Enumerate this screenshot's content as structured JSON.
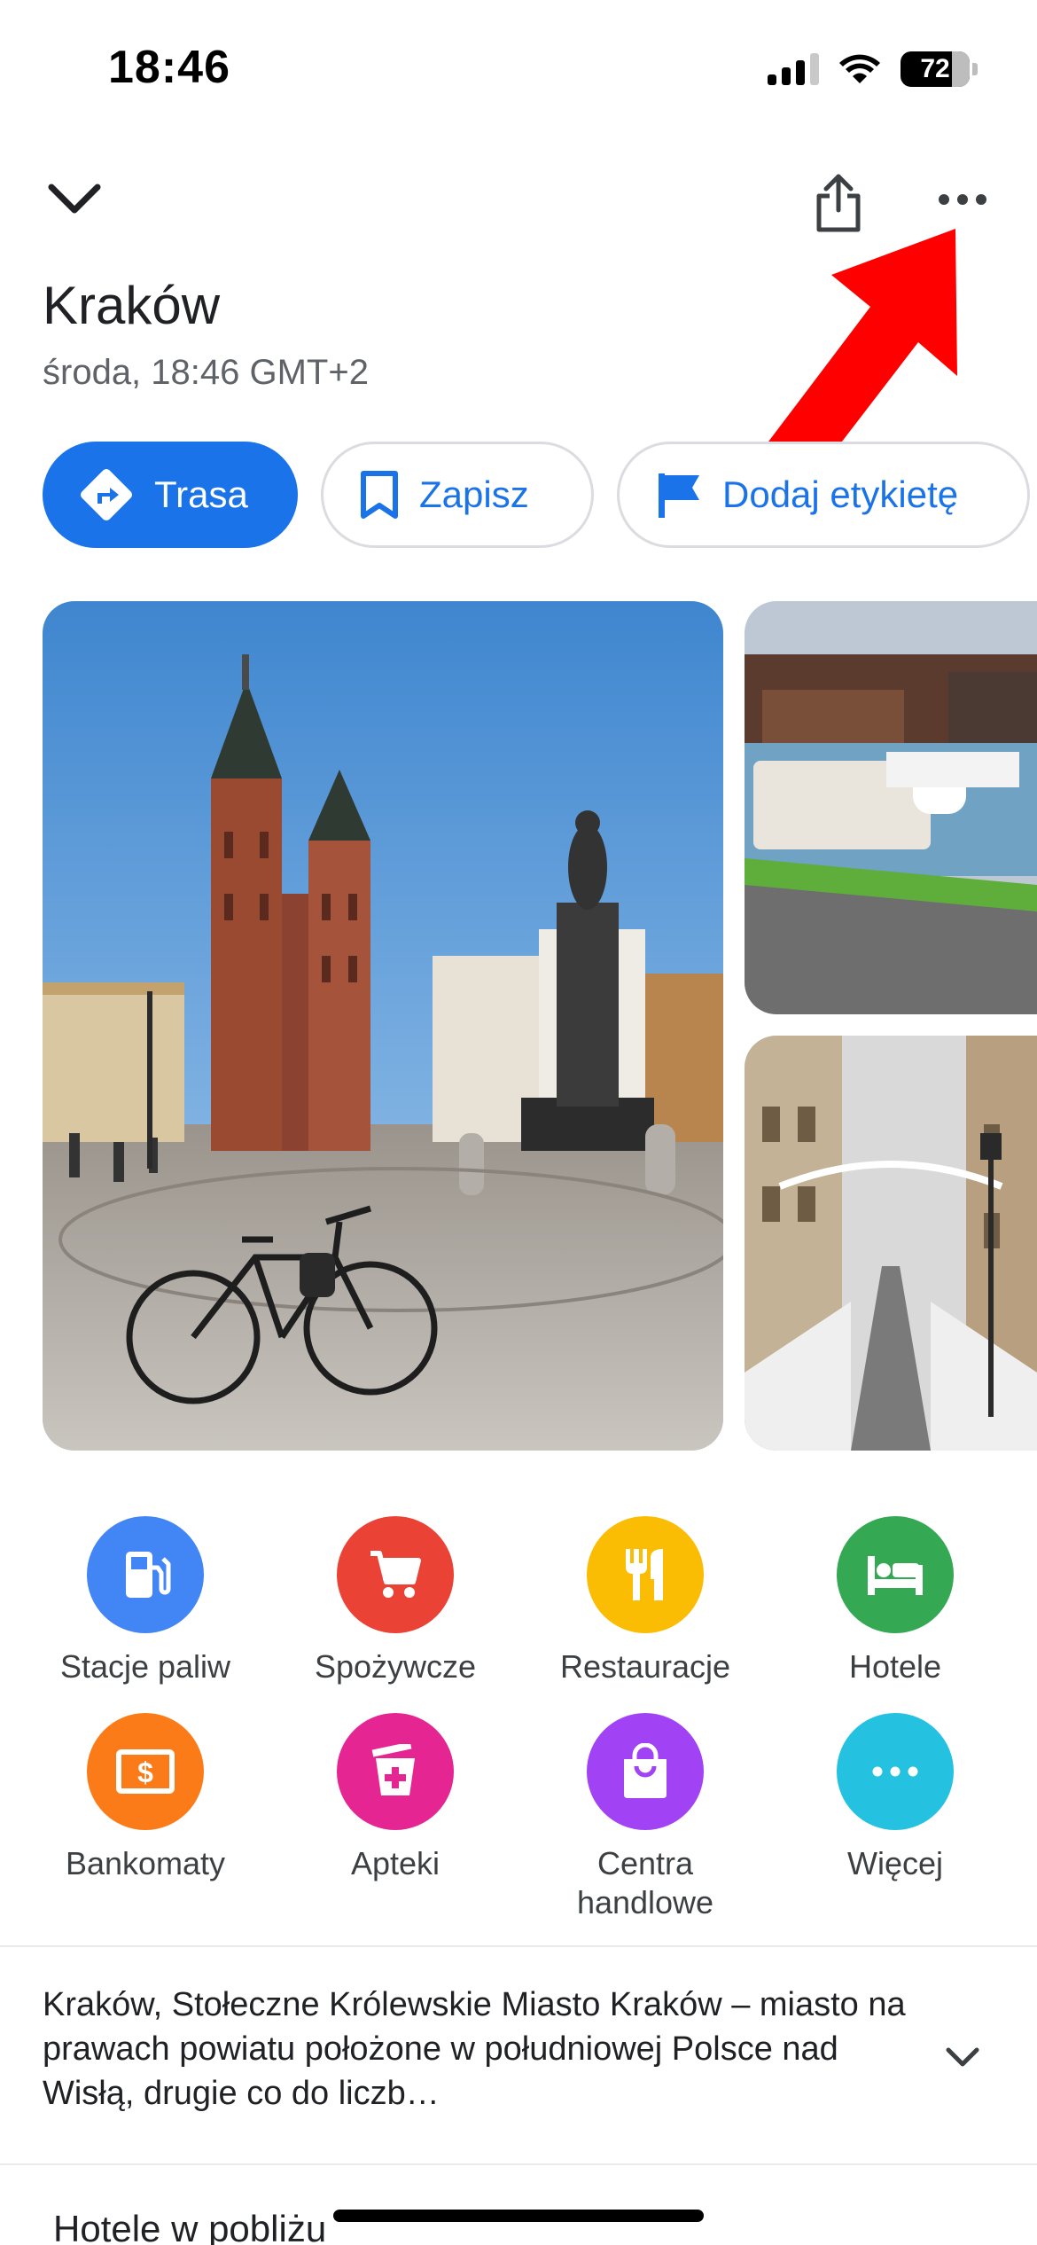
{
  "status_bar": {
    "time": "18:46",
    "battery": "72"
  },
  "place": {
    "title": "Kraków",
    "subtitle": "środa, 18:46 GMT+2"
  },
  "actions": {
    "directions": "Trasa",
    "save": "Zapisz",
    "label": "Dodaj etykietę"
  },
  "categories": [
    {
      "label": "Stacje paliw",
      "color": "#4285f4",
      "icon": "gas-station-icon"
    },
    {
      "label": "Spożywcze",
      "color": "#ea4335",
      "icon": "shopping-cart-icon"
    },
    {
      "label": "Restauracje",
      "color": "#fbbc04",
      "icon": "restaurant-icon"
    },
    {
      "label": "Hotele",
      "color": "#34a853",
      "icon": "bed-icon"
    },
    {
      "label": "Bankomaty",
      "color": "#fa7b17",
      "icon": "atm-icon"
    },
    {
      "label": "Apteki",
      "color": "#e52592",
      "icon": "pharmacy-icon"
    },
    {
      "label": "Centra handlowe",
      "color": "#a142f4",
      "icon": "shopping-bag-icon"
    },
    {
      "label": "Więcej",
      "color": "#24c1e0",
      "icon": "more-icon"
    }
  ],
  "description": "Kraków, Stołeczne Królewskie Miasto Kraków – miasto na prawach powiatu położone w południowej Polsce nad Wisłą, drugie co do liczb…",
  "nearby_section": "Hotele w pobliżu",
  "colors": {
    "accent": "#1a73e8",
    "annotation_arrow": "#ff0000"
  }
}
